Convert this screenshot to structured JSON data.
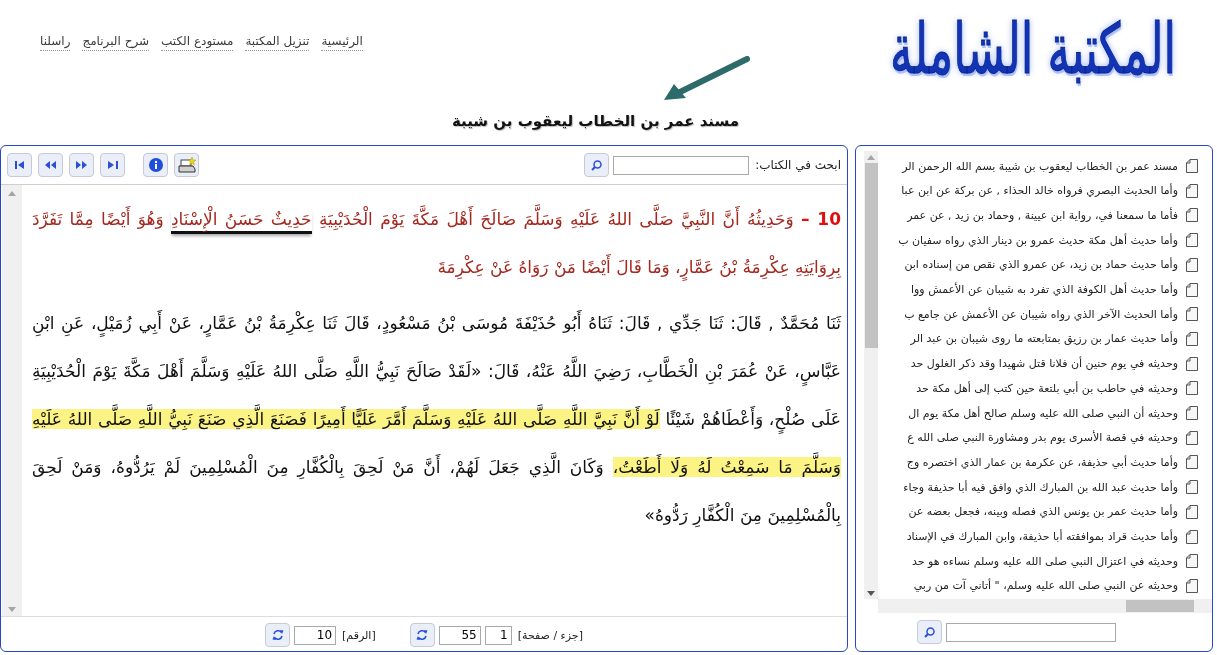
{
  "logo": "المكتبة الشاملة",
  "nav_links": [
    "الرئيسية",
    "تنزيل المكتبة",
    "مستودع الكتب",
    "شرح البرنامج",
    "راسلنا"
  ],
  "book_title": "مسند عمر بن الخطاب ليعقوب بن شيبة",
  "reader": {
    "search_label": "ابحث في الكتاب:",
    "paragraphs": [
      {
        "kind": "commentary",
        "segments": [
          {
            "kind": "plain",
            "text": "**10 –** وَحَدِيثُهُ أَنَّ النَّبِيَّ صَلَّى اللهُ عَلَيْهِ وَسَلَّمَ صَالَحَ أَهْلَ مَكَّةَ يَوْمَ الْحُدَيْبِيَةِ "
          },
          {
            "kind": "underline",
            "text": "حَدِيثٌ حَسَنُ الْإِسْنَادِ"
          },
          {
            "kind": "plain",
            "text": " وَهُوَ أَيْضًا مِمَّا تَفَرَّدَ بِرِوَايَتِهِ عِكْرِمَةُ بْنُ عَمَّارٍ، وَمَا قَالَ أَيْضًا مَنْ رَوَاهُ عَنْ عِكْرِمَةَ"
          }
        ]
      },
      {
        "kind": "narration",
        "segments": [
          {
            "kind": "plain",
            "text": "ثَنَا مُحَمَّدٌ , قَالَ: ثَنَا جَدِّي , قَالَ: ثَنَاهُ أَبُو حُذَيْفَةَ مُوسَى بْنُ مَسْعُودٍ، قَالَ ثَنَا عِكْرِمَةُ بْنُ عَمَّارٍ، عَنْ أَبِي زُمَيْلٍ، عَنِ ابْنِ عَبَّاسٍ، عَنْ عُمَرَ بْنِ الْخَطَّابِ، رَضِيَ اللَّهُ عَنْهُ، قَالَ: «لَقَدْ صَالَحَ نَبِيُّ اللَّهِ صَلَّى اللهُ عَلَيْهِ وَسَلَّمَ أَهْلَ مَكَّةَ يَوْمَ الْحُدَيْبِيَةِ عَلَى صُلْحٍ، وَأَعْطَاهُمْ شَيْئًا "
          },
          {
            "kind": "highlight",
            "text": "لَوْ أَنَّ نَبِيَّ اللَّهِ صَلَّى اللهُ عَلَيْهِ وَسَلَّمَ أَمَّرَ عَلَيًّا أَمِيرًا فَصَنَعَ الَّذِي صَنَعَ نَبِيُّ اللَّهِ صَلَّى اللهُ عَلَيْهِ وَسَلَّمَ مَا سَمِعْتُ لَهُ وَلَا أَطَعْتُ،"
          },
          {
            "kind": "plain",
            "text": " وَكَانَ الَّذِي جَعَلَ لَهُمْ، أَنَّ مَنْ لَحِقَ بِالْكُفَّارِ مِنَ الْمُسْلِمِينَ لَمْ يَرُدُّوهُ، وَمَنْ لَحِقَ بِالْمُسْلِمِينَ مِنَ الْكُفَّارِ رَدُّوهُ»"
          }
        ]
      }
    ],
    "page_label": "[جزء / صفحة]",
    "volume": "1",
    "page": "55",
    "number_label": "[الرقم]",
    "number": "10"
  },
  "sidebar": {
    "items": [
      "مسند عمر بن الخطاب ليعقوب بن شيبة بسم الله الرحمن الر",
      "وأما الحديث البصري فرواه خالد الحذاء , عن بركة عن ابن عبا",
      "فأما ما سمعنا في، رواية ابن عيينة , وحماد بن زيد , عن عمر",
      "وأما حديث أهل مكة حديث عمرو بن دينار الذي رواه سفيان ب",
      "وأما حديث حماد بن زيد، عن عمرو الذي نقص من إسناده ابن",
      "وأما حديث أهل الكوفة الذي تفرد به شيبان عن الأعمش ووا",
      "وأما الحديث الآخر الذي رواه شيبان عن الأعمش عن جامع ب",
      "وأما حديث عمار بن رزيق بمتابعته ما روى شيبان بن عبد الر",
      "وحديثه في يوم حنين أن فلانا قتل شهيدا وقد ذكر الغلول حد",
      "وحديثه في حاطب بن أبي بلتعة حين كتب إلى أهل مكة حد",
      "وحديثه أن النبي صلى الله عليه وسلم صالح أهل مكة يوم ال",
      "وحديثه في قصة الأسرى يوم بدر ومشاورة النبي صلى الله ع",
      "وأما حديث أبي حذيفة، عن عكرمة بن عمار الذي اختصره وج",
      "وأما حديث عبد الله بن المبارك الذي وافق فيه أبا حذيفة وجاء",
      "وأما حديث عمر بن يونس الذي فصله وبينه، فجعل بعضه عن",
      "وأما حديث قراد بموافقته أبا حذيفة، وابن المبارك في الإسناد",
      "وحديثه في اعتزال النبي صلى الله عليه وسلم نساءه هو حد",
      "وحديثه عن النبي صلى الله عليه وسلم، \" أتاني آت من ربي"
    ]
  }
}
